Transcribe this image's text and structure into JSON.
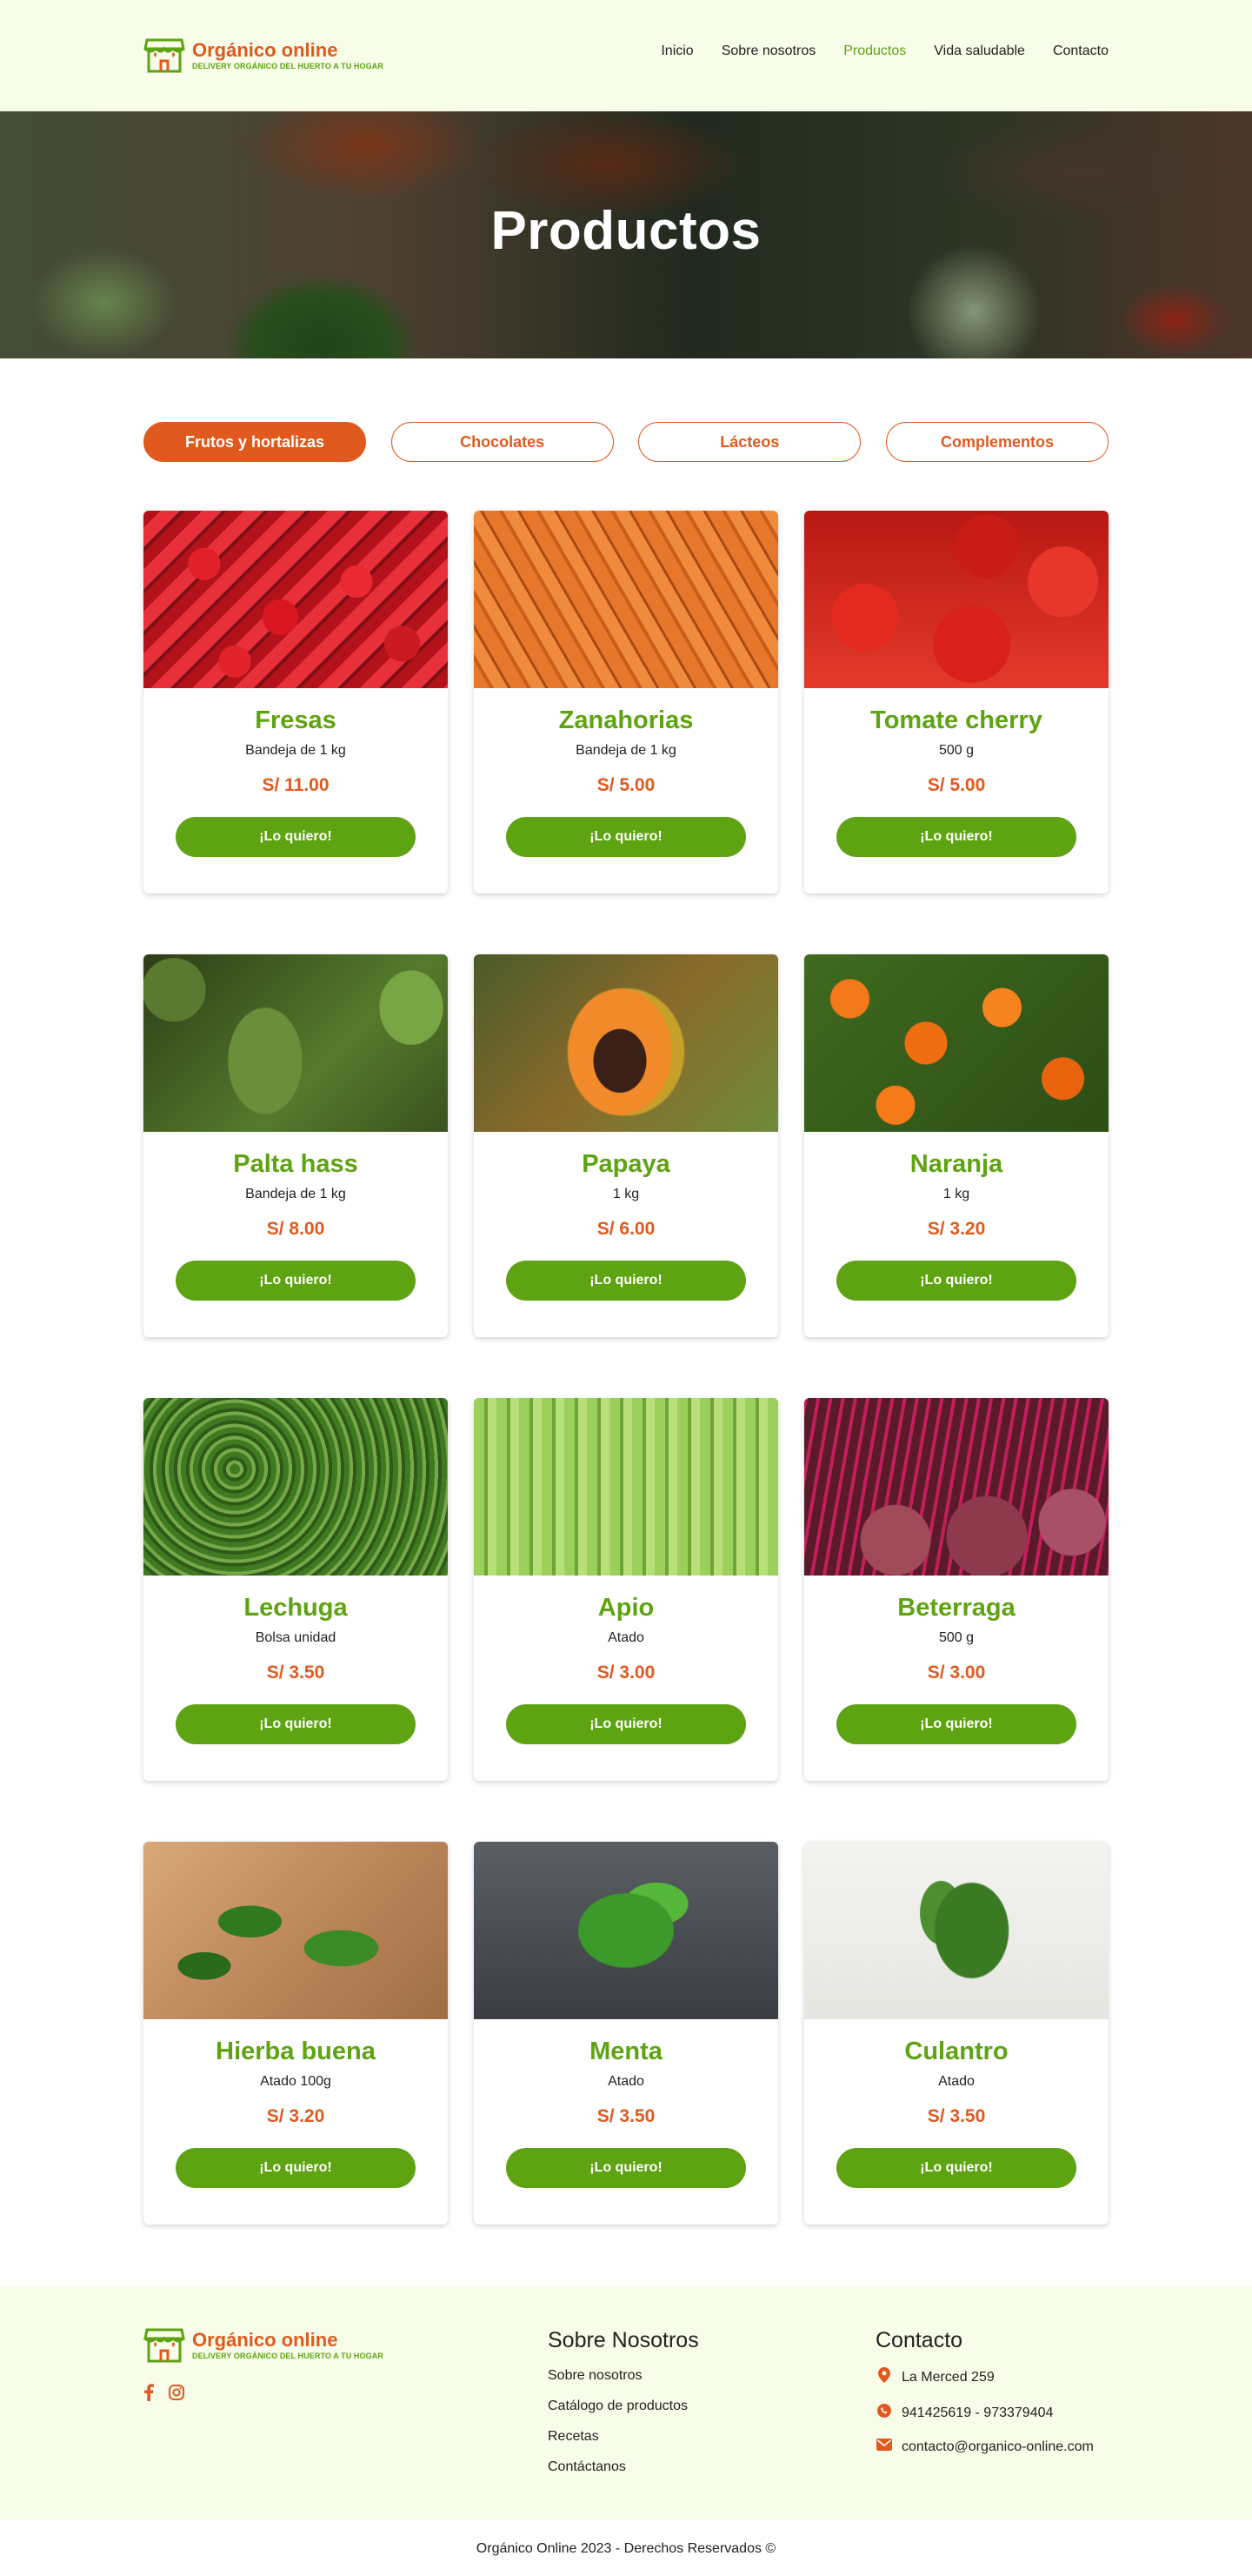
{
  "brand": {
    "name": "Orgánico online",
    "tagline": "DELIVERY ORGÁNICO DEL HUERTO A TU HOGAR",
    "primary_color": "#e05a1f",
    "accent_color": "#5ea312"
  },
  "nav": {
    "items": [
      {
        "label": "Inicio"
      },
      {
        "label": "Sobre nosotros"
      },
      {
        "label": "Productos",
        "active": true
      },
      {
        "label": "Vida saludable"
      },
      {
        "label": "Contacto"
      }
    ]
  },
  "hero": {
    "title": "Productos"
  },
  "tabs": [
    {
      "label": "Frutos y hortalizas",
      "active": true
    },
    {
      "label": "Chocolates"
    },
    {
      "label": "Lácteos"
    },
    {
      "label": "Complementos"
    }
  ],
  "products": [
    {
      "name": "Fresas",
      "desc": "Bandeja de 1 kg",
      "price": "S/ 11.00",
      "button": "¡Lo quiero!"
    },
    {
      "name": "Zanahorias",
      "desc": "Bandeja de 1 kg",
      "price": "S/ 5.00",
      "button": "¡Lo quiero!"
    },
    {
      "name": "Tomate cherry",
      "desc": "500 g",
      "price": "S/ 5.00",
      "button": "¡Lo quiero!"
    },
    {
      "name": "Palta hass",
      "desc": "Bandeja de 1 kg",
      "price": "S/ 8.00",
      "button": "¡Lo quiero!"
    },
    {
      "name": "Papaya",
      "desc": "1 kg",
      "price": "S/ 6.00",
      "button": "¡Lo quiero!"
    },
    {
      "name": "Naranja",
      "desc": "1 kg",
      "price": "S/ 3.20",
      "button": "¡Lo quiero!"
    },
    {
      "name": "Lechuga",
      "desc": "Bolsa unidad",
      "price": "S/ 3.50",
      "button": "¡Lo quiero!"
    },
    {
      "name": "Apio",
      "desc": "Atado",
      "price": "S/ 3.00",
      "button": "¡Lo quiero!"
    },
    {
      "name": "Beterraga",
      "desc": "500 g",
      "price": "S/ 3.00",
      "button": "¡Lo quiero!"
    },
    {
      "name": "Hierba buena",
      "desc": "Atado 100g",
      "price": "S/ 3.20",
      "button": "¡Lo quiero!"
    },
    {
      "name": "Menta",
      "desc": "Atado",
      "price": "S/ 3.50",
      "button": "¡Lo quiero!"
    },
    {
      "name": "Culantro",
      "desc": "Atado",
      "price": "S/ 3.50",
      "button": "¡Lo quiero!"
    }
  ],
  "footer": {
    "about": {
      "title": "Sobre Nosotros",
      "links": [
        "Sobre nosotros",
        "Catálogo de productos",
        "Recetas",
        "Contáctanos"
      ]
    },
    "contact": {
      "title": "Contacto",
      "address": "La Merced 259",
      "phone": "941425619 - 973379404",
      "email": "contacto@organico-online.com"
    },
    "social": [
      "facebook-icon",
      "instagram-icon"
    ],
    "copyright": "Orgánico Online 2023 - Derechos Reservados ©"
  }
}
